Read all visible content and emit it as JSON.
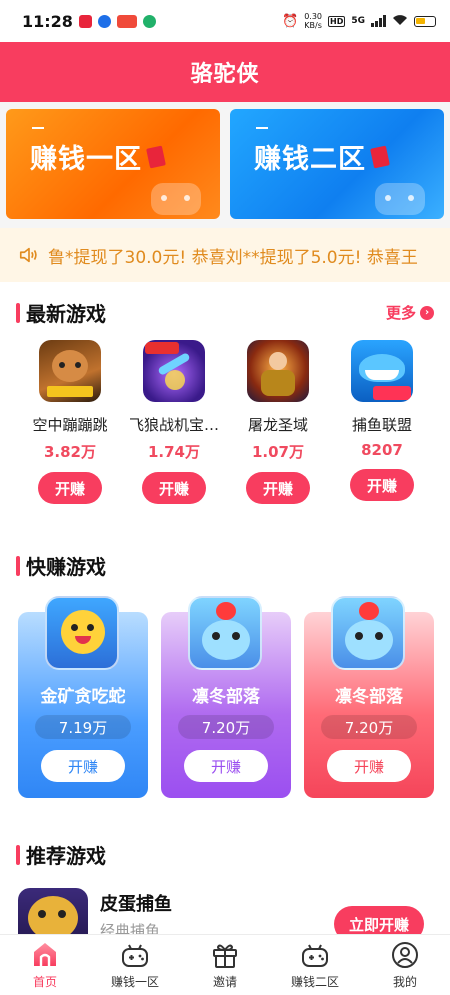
{
  "status_bar": {
    "time": "11:28",
    "net_speed": "0.30\nKB/s",
    "hd": "HD",
    "signal": "5G"
  },
  "header": {
    "title": "骆驼侠"
  },
  "zones": [
    {
      "label": "赚钱一区",
      "color": "#ff7a00"
    },
    {
      "label": "赚钱二区",
      "color": "#1290f6"
    }
  ],
  "marquee": {
    "text": "鲁*提现了30.0元!   恭喜刘**提现了5.0元!   恭喜王"
  },
  "latest": {
    "heading": "最新游戏",
    "more_label": "更多",
    "games": [
      {
        "name": "空中蹦蹦跳",
        "count": "3.82万",
        "button": "开赚",
        "icon": "dog-game-icon"
      },
      {
        "name": "飞狼战机宝…",
        "count": "1.74万",
        "button": "开赚",
        "icon": "fighter-jet-game-icon"
      },
      {
        "name": "屠龙圣域",
        "count": "1.07万",
        "button": "开赚",
        "icon": "warrior-game-icon"
      },
      {
        "name": "捕鱼联盟",
        "count": "8207",
        "button": "开赚",
        "icon": "shark-fishing-game-icon"
      }
    ]
  },
  "quick": {
    "heading": "快赚游戏",
    "cards": [
      {
        "name": "金矿贪吃蛇",
        "count": "7.19万",
        "button": "开赚",
        "accent": "#2f86f5"
      },
      {
        "name": "凛冬部落",
        "count": "7.20万",
        "button": "开赚",
        "accent": "#9b4ff0"
      },
      {
        "name": "凛冬部落",
        "count": "7.20万",
        "button": "开赚",
        "accent": "#f5455a"
      }
    ]
  },
  "recommended": {
    "heading": "推荐游戏",
    "item": {
      "title": "皮蛋捕鱼",
      "subtitle": "经典捕鱼",
      "button": "立即开赚"
    }
  },
  "tabbar": {
    "tabs": [
      {
        "label": "首页",
        "active": true
      },
      {
        "label": "赚钱一区",
        "active": false
      },
      {
        "label": "邀请",
        "active": false
      },
      {
        "label": "赚钱二区",
        "active": false
      },
      {
        "label": "我的",
        "active": false
      }
    ]
  },
  "colors": {
    "brand": "#f83d5f",
    "marquee_text": "#e08b1f"
  }
}
